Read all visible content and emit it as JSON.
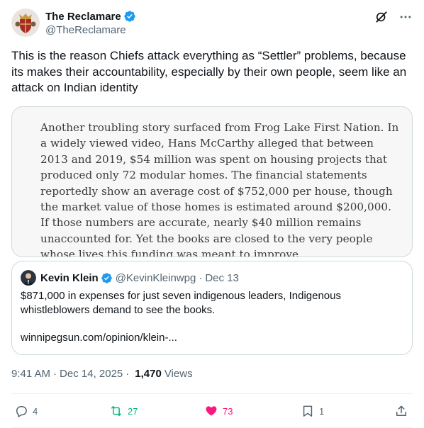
{
  "author": {
    "display_name": "The Reclamare",
    "handle": "@TheReclamare"
  },
  "tweet": {
    "text": "This is the reason Chiefs attack everything as “Settler” problems, because its makes their accountability, especially by their own people, seem like an attack on Indian identity"
  },
  "image_card": {
    "text": "Another troubling story surfaced from Frog Lake First Nation. In a widely viewed video, Hans McCarthy alleged that between 2013 and 2019, $54 million was spent on housing projects that produced only 72 modular homes. The financial statements reportedly show an average cost of $752,000 per house, though the market value of those homes is estimated around $200,000. If those numbers are accurate, nearly $40 million remains unaccounted for. Yet the books are closed to the very people whose lives this funding was meant to improve."
  },
  "quote": {
    "display_name": "Kevin Klein",
    "handle": "@KevinKleinwpg",
    "separator": "·",
    "date": "Dec 13",
    "text": "$871,000 in expenses for just seven indigenous leaders, Indigenous whistleblowers demand to see the books.",
    "link": "winnipegsun.com/opinion/klein-..."
  },
  "meta": {
    "time": "9:41 AM",
    "separator": "·",
    "date": "Dec 14, 2025",
    "separator2": "·",
    "views_count": "1,470",
    "views_label": "Views"
  },
  "actions": {
    "replies": "4",
    "reposts": "27",
    "likes": "73",
    "bookmarks": "1"
  },
  "colors": {
    "verified": "#1d9bf0",
    "repost_active": "#00ba7c",
    "like_active": "#f91880",
    "secondary_text": "#536471"
  },
  "icons": [
    "verified-badge-icon",
    "grok-icon",
    "more-icon",
    "reply-icon",
    "repost-icon",
    "like-icon",
    "bookmark-icon",
    "share-icon"
  ]
}
